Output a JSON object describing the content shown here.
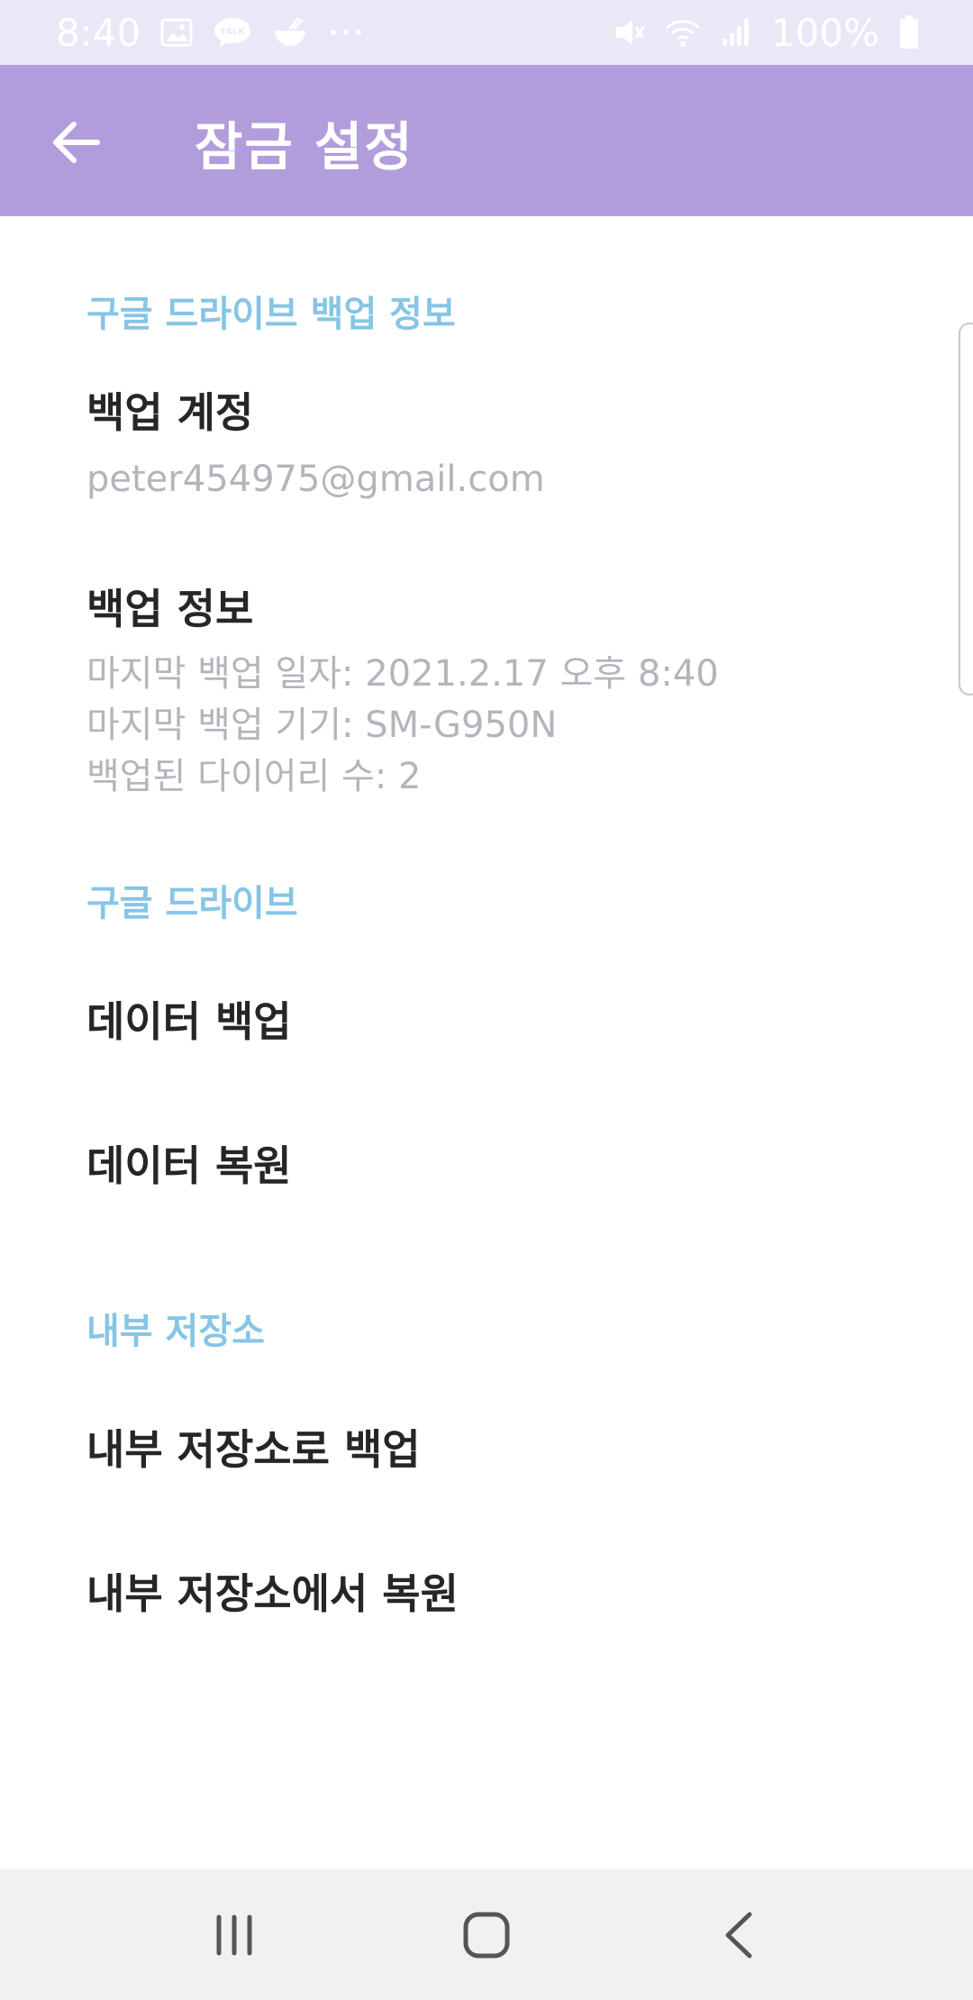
{
  "status_bar": {
    "time": "8:40",
    "battery": "100%",
    "left_icons": [
      "gallery-icon",
      "kakaotalk-icon",
      "food-icon",
      "more-notifications-icon"
    ],
    "right_icons": [
      "mute-icon",
      "wifi-icon",
      "signal-icon",
      "battery-icon"
    ],
    "notification_badge": "TALK"
  },
  "app_bar": {
    "title": "잠금 설정",
    "back_icon": "arrow-left-icon",
    "color": "#b19ddb"
  },
  "sections": {
    "google_backup_info": {
      "header": "구글 드라이브 백업 정보",
      "account": {
        "title": "백업 계정",
        "summary": "peter454975@gmail.com"
      },
      "info": {
        "title": "백업 정보",
        "lines": [
          "마지막 백업 일자: 2021.2.17  오후 8:40",
          "마지막 백업 기기: SM-G950N",
          "백업된 다이어리 수: 2"
        ]
      }
    },
    "google_drive": {
      "header": "구글 드라이브",
      "backup": "데이터 백업",
      "restore": "데이터 복원"
    },
    "internal_storage": {
      "header": "내부 저장소",
      "backup": "내부 저장소로 백업",
      "restore": "내부 저장소에서 복원"
    }
  },
  "colors": {
    "section_header": "#86c5e5",
    "title_text": "#262626",
    "summary_text": "#b4b4bc",
    "nav_bar": "#f1f1f1"
  },
  "nav_bar": {
    "icons": [
      "recents-icon",
      "home-icon",
      "back-icon"
    ]
  }
}
